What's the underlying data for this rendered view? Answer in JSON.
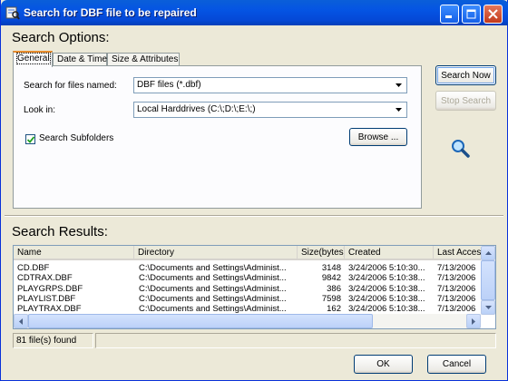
{
  "window": {
    "title": "Search for DBF file to be repaired",
    "controls": {
      "minimize": "minimize",
      "maximize": "maximize",
      "close": "close"
    }
  },
  "search_options": {
    "heading": "Search Options:",
    "tabs": [
      {
        "label": "General",
        "active": true
      },
      {
        "label": "Date & Time",
        "active": false
      },
      {
        "label": "Size & Attributes",
        "active": false
      }
    ],
    "files_named_label": "Search for files named:",
    "files_named_value": "DBF files (*.dbf)",
    "look_in_label": "Look in:",
    "look_in_value": "Local Harddrives (C:\\;D:\\;E:\\;)",
    "subfolders_label": "Search Subfolders",
    "subfolders_checked": true,
    "browse_label": "Browse ..."
  },
  "actions": {
    "search_now": "Search Now",
    "stop_search": "Stop Search"
  },
  "search_results": {
    "heading": "Search Results:",
    "columns": [
      "Name",
      "Directory",
      "Size(bytes)",
      "Created",
      "Last Access"
    ],
    "rows": [
      [
        "CD.DBF",
        "C:\\Documents and Settings\\Administ...",
        "3148",
        "3/24/2006 5:10:30...",
        "7/13/2006"
      ],
      [
        "CDTRAX.DBF",
        "C:\\Documents and Settings\\Administ...",
        "9842",
        "3/24/2006 5:10:38...",
        "7/13/2006"
      ],
      [
        "PLAYGRPS.DBF",
        "C:\\Documents and Settings\\Administ...",
        "386",
        "3/24/2006 5:10:38...",
        "7/13/2006"
      ],
      [
        "PLAYLIST.DBF",
        "C:\\Documents and Settings\\Administ...",
        "7598",
        "3/24/2006 5:10:38...",
        "7/13/2006"
      ],
      [
        "PLAYTRAX.DBF",
        "C:\\Documents and Settings\\Administ...",
        "162",
        "3/24/2006 5:10:38...",
        "7/13/2006"
      ]
    ]
  },
  "status": {
    "found": "81 file(s) found"
  },
  "footer": {
    "ok": "OK",
    "cancel": "Cancel"
  },
  "colors": {
    "titlebar": "#0554e3",
    "accent_tab": "#e68b2c",
    "dialog_bg": "#ece9d8"
  }
}
